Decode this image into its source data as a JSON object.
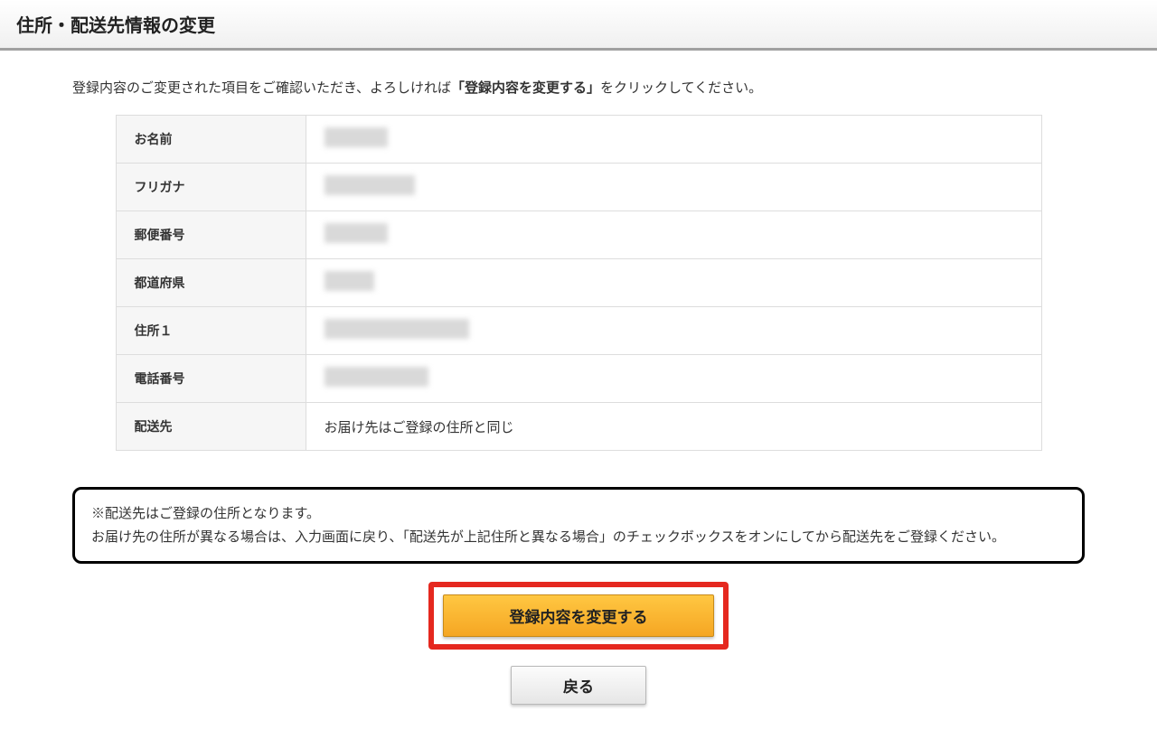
{
  "header": {
    "title": "住所・配送先情報の変更"
  },
  "intro": {
    "prefix": "登録内容のご変更された項目をご確認いただき、よろしければ",
    "bold": "「登録内容を変更する」",
    "suffix": "をクリックしてください。"
  },
  "fields": {
    "name_label": "お名前",
    "furigana_label": "フリガナ",
    "postal_label": "郵便番号",
    "pref_label": "都道府県",
    "addr1_label": "住所１",
    "phone_label": "電話番号",
    "delivery_label": "配送先",
    "delivery_value": "お届け先はご登録の住所と同じ"
  },
  "notice": {
    "line1": "※配送先はご登録の住所となります。",
    "line2": "お届け先の住所が異なる場合は、入力画面に戻り、「配送先が上記住所と異なる場合」のチェックボックスをオンにしてから配送先をご登録ください。"
  },
  "buttons": {
    "submit": "登録内容を変更する",
    "back": "戻る"
  }
}
